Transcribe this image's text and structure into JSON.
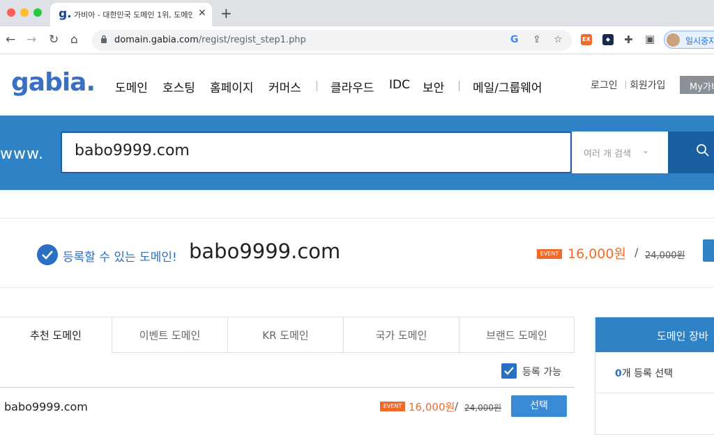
{
  "browser": {
    "tab_title": "가비아 - 대한민국 도메인 1위, 도메인",
    "tab_favicon": "g.",
    "url_host": "domain.gabia.com",
    "url_path": "/regist/regist_step1.php",
    "profile_label": "일시중지",
    "extension_ex": "EX"
  },
  "header": {
    "logo": "gabia.",
    "menu": [
      "도메인",
      "호스팅",
      "홈페이지",
      "커머스",
      "클라우드",
      "IDC",
      "보안",
      "메일/그룹웨어"
    ],
    "login": "로그인",
    "signup": "회원가입",
    "my": "My가비"
  },
  "search": {
    "prefix": "www.",
    "value": "babo9999.com",
    "multi_label": "여러 개 검색"
  },
  "result": {
    "status": "등록할 수 있는 도메인!",
    "domain": "babo9999.com",
    "badge": "EVENT",
    "price": "16,000원",
    "slash": "/",
    "old_price": "24,000원"
  },
  "tabs": [
    "추천 도메인",
    "이벤트 도메인",
    "KR 도메인",
    "국가 도메인",
    "브랜드 도메인"
  ],
  "filter": {
    "label": "등록 가능",
    "checked": true
  },
  "rows": [
    {
      "domain": "babo9999.com",
      "badge": "EVENT",
      "price": "16,000원",
      "slash": "/",
      "old_price": "24,000원",
      "action": "선택"
    }
  ],
  "cart": {
    "title": "도메인 장바",
    "count_num": "0",
    "count_text": "개 등록 선택"
  },
  "colors": {
    "brand_blue": "#2f82c6",
    "event_orange": "#f06b2a",
    "text_blue": "#2a6fc4"
  }
}
